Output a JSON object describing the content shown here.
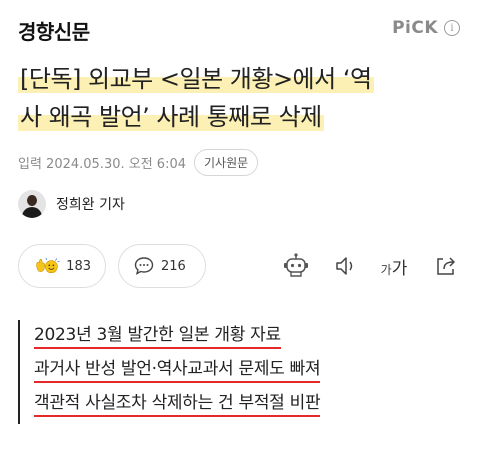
{
  "header": {
    "logo": "경향신문",
    "pick_label": "PiCK",
    "info_glyph": "i"
  },
  "headline": {
    "lines": [
      "[단독] 외교부 <일본 개황>에서 ‘역",
      "사 왜곡 발언’ 사례 통째로 삭제"
    ],
    "highlight_color": "#fdf0b5"
  },
  "meta": {
    "dateline": "입력 2024.05.30. 오전 6:04",
    "source_button": "기사원문"
  },
  "reporter": {
    "name": "정희완 기자"
  },
  "actions": {
    "reactions": {
      "icon": "reaction-emoji-icon",
      "count": "183"
    },
    "comments": {
      "icon": "comment-icon",
      "count": "216"
    },
    "tools": [
      {
        "icon": "summary-bot-icon"
      },
      {
        "icon": "audio-icon"
      },
      {
        "icon": "font-size-icon",
        "small": "가",
        "big": "가"
      },
      {
        "icon": "share-icon"
      }
    ]
  },
  "summary": {
    "lines": [
      "2023년 3월 발간한 일본 개황 자료",
      "과거사 반성 발언·역사교과서 문제도 빠져",
      "객관적 사실조차 삭제하는 건 부적절 비판"
    ],
    "underline_color": "#e5292b"
  }
}
